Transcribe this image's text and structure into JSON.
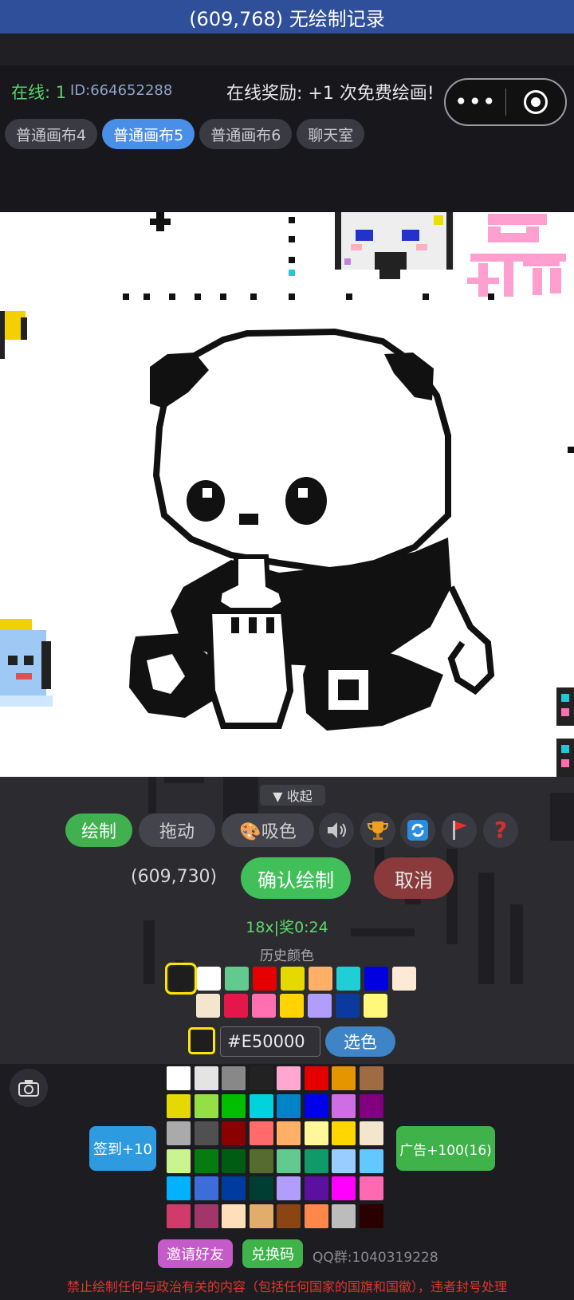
{
  "app": {
    "title": "(609,768) 无绘制记录"
  },
  "header": {
    "online": "在线: 1",
    "user_id": "ID:664652288",
    "reward_notice": "在线奖励: +1 次免费绘画!",
    "more_icon": "more-dots-icon",
    "close_icon": "target-circle-icon"
  },
  "tabs": [
    {
      "label": "普通画布4",
      "active": false
    },
    {
      "label": "普通画布5",
      "active": true
    },
    {
      "label": "普通画布6",
      "active": false
    },
    {
      "label": "聊天室",
      "active": false
    }
  ],
  "panel": {
    "collapse_label": "▼ 收起",
    "draw_label": "绘制",
    "drag_label": "拖动",
    "pick_label": "🎨吸色",
    "icons": [
      "speaker-icon",
      "trophy-icon",
      "refresh-icon",
      "flag-icon",
      "help-icon"
    ],
    "coordinate": "(609,730)",
    "confirm_label": "确认绘制",
    "cancel_label": "取消",
    "reward_timer": "18x|奖0:24",
    "history_label": "历史颜色",
    "history_colors": [
      [
        "#1e1e1e",
        "#ffffff",
        "#62c98f",
        "#e50000",
        "#e5d900",
        "#ffb066",
        "#1ecfd6",
        "#0000e0",
        "#fde9d6"
      ],
      [
        "#f3e6cc",
        "#e5174a",
        "#ff70b0",
        "#ffd400",
        "#b19dfd",
        "#0a3aa0",
        "#fff87a"
      ]
    ],
    "current_color": "#1e1e1e",
    "hex_value": "#E50000",
    "select_label": "选色"
  },
  "bottom": {
    "camera_icon": "camera-icon",
    "checkin_label": "签到+10",
    "ad_label": "广告+100(16)",
    "palette": [
      [
        "#ffffff",
        "#e4e4e4",
        "#888888",
        "#222222",
        "#ffa7d1",
        "#e50000",
        "#e59500",
        "#a06a42"
      ],
      [
        "#e5d900",
        "#94e044",
        "#02be01",
        "#00d3dd",
        "#0083c7",
        "#0000ea",
        "#cf6ee4",
        "#820080"
      ],
      [
        "#aaaaaa",
        "#505050",
        "#8b0000",
        "#ff6b6b",
        "#ffb066",
        "#fff79a",
        "#ffd700",
        "#f3e6cc"
      ],
      [
        "#c9f48f",
        "#077b10",
        "#005c12",
        "#556b2f",
        "#62c98f",
        "#0f9a6a",
        "#99ccff",
        "#62c8ff"
      ],
      [
        "#00b2ff",
        "#3c6ddb",
        "#003ca0",
        "#003d33",
        "#b19dfd",
        "#5c10a0",
        "#ff00ff",
        "#ff69b4"
      ],
      [
        "#d13b6b",
        "#a2366b",
        "#ffdfba",
        "#e2ad6a",
        "#8b4513",
        "#ff8749",
        "#bcbcbc",
        "#2a0000"
      ]
    ],
    "invite_label": "邀请好友",
    "code_label": "兑换码",
    "qq_group": "QQ群:1040319228",
    "warning": "禁止绘制任何与政治有关的内容（包括任何国家的国旗和国徽），违者封号处理"
  }
}
